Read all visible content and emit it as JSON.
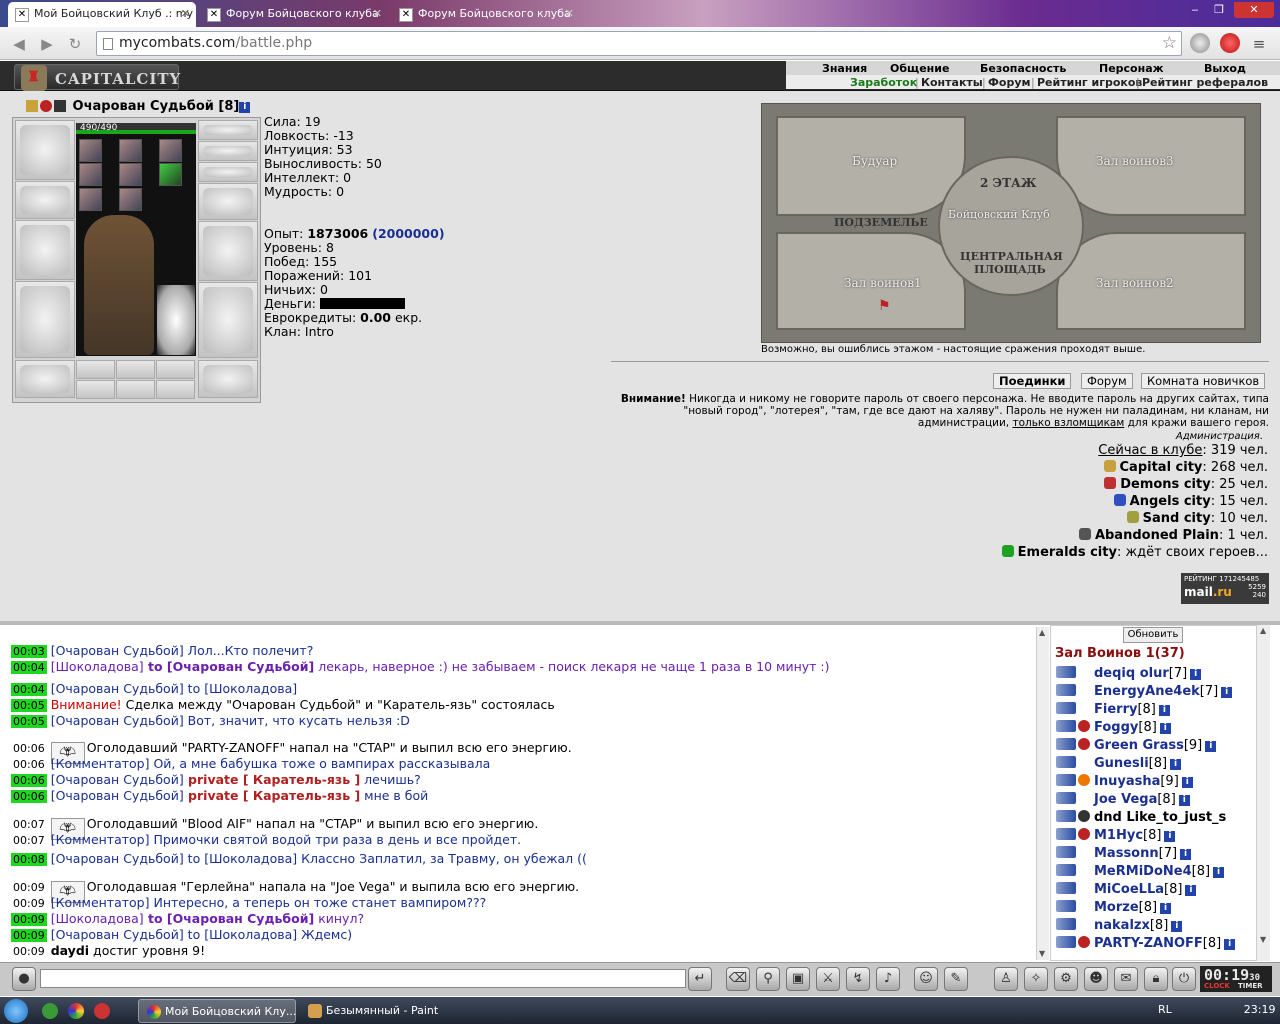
{
  "browser": {
    "tabs": [
      {
        "title": "Мой Бойцовский Клуб .: my",
        "active": true
      },
      {
        "title": "Форум Бойцовского клуба",
        "active": false
      },
      {
        "title": "Форум Бойцовского клуба",
        "active": false
      }
    ],
    "url_host": "mycombats.com",
    "url_path": "/battle.php"
  },
  "header": {
    "logo": "CAPITALCITY",
    "top_menu": [
      "Знания",
      "Общение",
      "Безопасность",
      "Персонаж",
      "Выход"
    ],
    "sub_menu": [
      "Заработок",
      "Контакты",
      "Форум",
      "Рейтинг игроков",
      "Рейтинг рефералов"
    ]
  },
  "character": {
    "name": "Очарован Судьбой",
    "level": "[8]",
    "hp": "490/490",
    "hp_fraction": 1.0,
    "stats": [
      "Сила: 19",
      "Ловкость: -13",
      "Интуиция: 53",
      "Выносливость: 50",
      "Интеллект: 0",
      "Мудрость: 0"
    ],
    "exp_label": "Опыт:",
    "exp_value": "1873006",
    "exp_next": "(2000000)",
    "level_line": "Уровень: 8",
    "wins": "Побед: 155",
    "losses": "Поражений: 101",
    "draws": "Ничьих: 0",
    "money_label": "Деньги:",
    "euro_label": "Еврокредиты:",
    "euro_value": "0.00",
    "euro_unit": "екр.",
    "clan": "Клан: Intro"
  },
  "map": {
    "rooms": [
      "Будуар",
      "Зал воинов3",
      "2 ЭТАЖ",
      "Бойцовский Клуб",
      "ПОДЗЕМЕЛЬЕ",
      "ЦЕНТРАЛЬНАЯ",
      "ПЛОЩАДЬ",
      "Зал воинов1",
      "Зал воинов2"
    ],
    "caption": "Возможно, вы ошиблись этажом - настоящие сражения проходят выше."
  },
  "actions": [
    "Поединки",
    "Форум",
    "Комната новичков"
  ],
  "warning": {
    "bold": "Внимание!",
    "text1": " Никогда и никому не говорите пароль от своего персонажа. Не вводите пароль на других сайтах, типа \"новый город\", \"лотерея\", \"там, где все дают на халяву\". Пароль не нужен ни паладинам, ни кланам, ни администрации, ",
    "link": "только взломщикам",
    "text2": " для кражи вашего героя.",
    "signature": "Администрация."
  },
  "online": {
    "label": "Сейчас в клубе",
    "total": ": 319 чел.",
    "cities": [
      {
        "name": "Capital city",
        "count": ": 268 чел.",
        "color": "#c8a040"
      },
      {
        "name": "Demons city",
        "count": ": 25 чел.",
        "color": "#c03030"
      },
      {
        "name": "Angels city",
        "count": ": 15 чел.",
        "color": "#3050c0"
      },
      {
        "name": "Sand city",
        "count": ": 10 чел.",
        "color": "#a0a040"
      },
      {
        "name": "Abandoned Plain",
        "count": ": 1 чел.",
        "color": "#555555"
      },
      {
        "name": "Emeralds city",
        "count": ": ждёт своих героев...",
        "color": "#20a020"
      }
    ]
  },
  "counter": {
    "title": "РЕЙТИНГ 171245485",
    "n1": "5259",
    "n2": "240",
    "brand1": "mail",
    "brand2": ".ru"
  },
  "chat": [
    {
      "time": "00:03",
      "hl": true,
      "nick": "[Очарован Судьбой]",
      "to": "",
      "text": " Лол...Кто полечит?",
      "kind": "msg"
    },
    {
      "time": "00:04",
      "hl": true,
      "nick": "[Шоколадова]",
      "to": " to [Очарован Судьбой]",
      "text": " лекарь, наверное :) не забываем - поиск лекаря не чаще 1 раза в 10 минут :)",
      "kind": "tomsg"
    },
    {
      "time": "00:04",
      "hl": true,
      "nick": "[Очарован Судьбой]",
      "to": " to [Шоколадова]",
      "text": "",
      "kind": "msg"
    },
    {
      "time": "00:05",
      "hl": true,
      "nick": "",
      "to": "",
      "text": "Внимание!|Сделка между \"Очарован Судьбой\" и \"Каратель-язь\" состоялась",
      "kind": "warn"
    },
    {
      "time": "00:05",
      "hl": true,
      "nick": "[Очарован Судьбой]",
      "to": "",
      "text": " Вот, значит, что кусать нельзя :D",
      "kind": "msg"
    },
    {
      "time": "00:06",
      "hl": false,
      "nick": "",
      "to": "",
      "text": "Оголодавший \"PARTY-ZANOFF\" напал на \"CTAP\" и выпил всю его энергию.",
      "kind": "event"
    },
    {
      "time": "00:06",
      "hl": false,
      "nick": "[Комментатор]",
      "to": "",
      "text": " Ой, а мне бабушка тоже о вампирах рассказывала",
      "kind": "msg"
    },
    {
      "time": "00:06",
      "hl": true,
      "nick": "[Очарован Судьбой]",
      "to": " private [ Каратель-язь ]",
      "text": " лечишь?",
      "kind": "priv"
    },
    {
      "time": "00:06",
      "hl": true,
      "nick": "[Очарован Судьбой]",
      "to": " private [ Каратель-язь ]",
      "text": " мне в бой",
      "kind": "priv"
    },
    {
      "time": "00:07",
      "hl": false,
      "nick": "",
      "to": "",
      "text": "Оголодавший \"Blood AIF\" напал на \"CTAP\" и выпил всю его энергию.",
      "kind": "event"
    },
    {
      "time": "00:07",
      "hl": false,
      "nick": "[Комментатор]",
      "to": "",
      "text": " Примочки святой водой три раза в день и все пройдет.",
      "kind": "msg"
    },
    {
      "time": "00:08",
      "hl": true,
      "nick": "[Очарован Судьбой]",
      "to": " to [Шоколадова]",
      "text": " Классно Заплатил, за Травму, он убежал ((",
      "kind": "msg"
    },
    {
      "time": "00:09",
      "hl": false,
      "nick": "",
      "to": "",
      "text": "Оголодавшая \"Герлейна\" напала на \"Joe Vega\" и выпила всю его энергию.",
      "kind": "event"
    },
    {
      "time": "00:09",
      "hl": false,
      "nick": "[Комментатор]",
      "to": "",
      "text": " Интересно, а теперь он тоже станет вампиром???",
      "kind": "msg"
    },
    {
      "time": "00:09",
      "hl": true,
      "nick": "[Шоколадова]",
      "to": " to [Очарован Судьбой]",
      "text": " кинул?",
      "kind": "tomsg"
    },
    {
      "time": "00:09",
      "hl": true,
      "nick": "[Очарован Судьбой]",
      "to": " to [Шоколадова]",
      "text": " Ждемс)",
      "kind": "msg"
    },
    {
      "time": "00:09",
      "hl": false,
      "nick": "daydi",
      "to": "",
      "text": " достиг уровня 9!",
      "kind": "level"
    }
  ],
  "room": {
    "refresh": "Обновить",
    "title": "Зал Воинов 1(37)",
    "players": [
      {
        "name": "deqiq olur",
        "lvl": "[7]"
      },
      {
        "name": "EnergyAne4ek",
        "lvl": "[7]"
      },
      {
        "name": "Fierry",
        "lvl": "[8]"
      },
      {
        "name": "Foggy",
        "lvl": "[8]"
      },
      {
        "name": "Green Grass",
        "lvl": "[9]"
      },
      {
        "name": "Gunesli",
        "lvl": "[8]"
      },
      {
        "name": "Inuyasha",
        "lvl": "[9]"
      },
      {
        "name": "Joe Vega",
        "lvl": "[8]"
      },
      {
        "name": "dnd Like_to_just_s",
        "lvl": ""
      },
      {
        "name": "M1Hyc",
        "lvl": "[8]"
      },
      {
        "name": "Massonn",
        "lvl": "[7]"
      },
      {
        "name": "MeRMiDoNe4",
        "lvl": "[8]"
      },
      {
        "name": "MiCoeLLa",
        "lvl": "[8]"
      },
      {
        "name": "Morze",
        "lvl": "[8]"
      },
      {
        "name": "nakalzx",
        "lvl": "[8]"
      },
      {
        "name": "PARTY-ZANOFF",
        "lvl": "[8]"
      }
    ]
  },
  "clock": {
    "time": "00:19",
    "sec": "30",
    "lab1": "CLOCK",
    "lab2": "TIMER"
  },
  "taskbar": {
    "items": [
      "Мой Бойцовский Клу...",
      "Безымянный - Paint"
    ],
    "lang": "RL",
    "time": "23:19"
  }
}
